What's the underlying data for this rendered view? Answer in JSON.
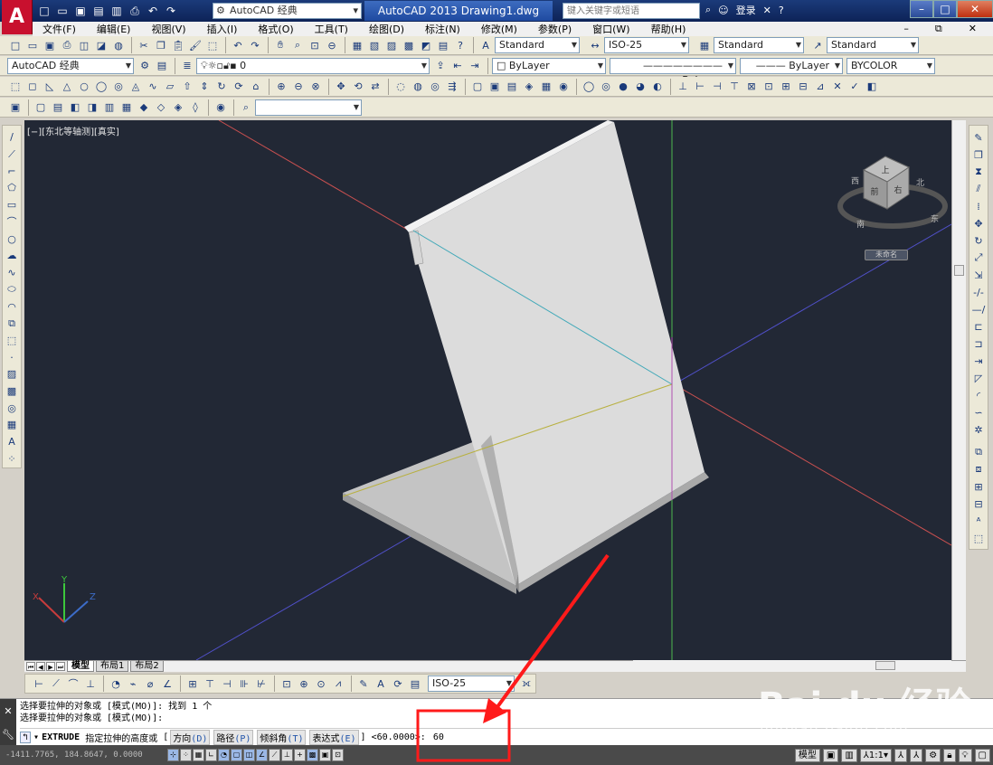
{
  "app": {
    "logo": "A",
    "workspace": "AutoCAD 经典",
    "title": "AutoCAD 2013    Drawing1.dwg",
    "search_placeholder": "键入关键字或短语",
    "login": "登录",
    "help": "?"
  },
  "menu": [
    "文件(F)",
    "编辑(E)",
    "视图(V)",
    "插入(I)",
    "格式(O)",
    "工具(T)",
    "绘图(D)",
    "标注(N)",
    "修改(M)",
    "参数(P)",
    "窗口(W)",
    "帮助(H)"
  ],
  "styles": {
    "text_style": "Standard",
    "dim_style": "ISO-25",
    "table_style": "Standard",
    "multileader_style": "Standard"
  },
  "layers": {
    "workspace_combo": "AutoCAD 经典",
    "layer_name": "0",
    "color": "ByLayer",
    "linetype": "ByLayer",
    "lineweight": "ByLayer",
    "plot_style": "BYCOLOR"
  },
  "viewport": {
    "label": "[−][东北等轴测][真实]",
    "viewcube_top": "上",
    "viewcube_front": "前",
    "viewcube_right": "右",
    "compass_n": "北",
    "compass_e": "东",
    "compass_s": "南",
    "compass_w": "西",
    "ucs_label": "未命名",
    "ucs_axes": {
      "x": "X",
      "y": "Y",
      "z": "Z"
    }
  },
  "layout_tabs": [
    "模型",
    "布局1",
    "布局2"
  ],
  "dim_toolbar": {
    "dim_style": "ISO-25"
  },
  "command": {
    "history": [
      "选择要拉伸的对象或 [模式(MO)]: 找到 1 个",
      "选择要拉伸的对象或 [模式(MO)]:"
    ],
    "prompt_cmd": "EXTRUDE",
    "prompt_text": "指定拉伸的高度或",
    "options": [
      {
        "label": "方向",
        "key": "(D)"
      },
      {
        "label": "路径",
        "key": "(P)"
      },
      {
        "label": "倾斜角",
        "key": "(T)"
      },
      {
        "label": "表达式",
        "key": "(E)"
      }
    ],
    "default": "<60.0000>:",
    "input_value": "60"
  },
  "status": {
    "coords": "-1411.7765, 184.8647, 0.0000",
    "model": "模型",
    "scale": "1:1"
  },
  "watermark": {
    "brand": "Bai du 经验",
    "url": "jingyan.baidu.com"
  },
  "colors": {
    "canvas_bg": "#222835",
    "highlight_box": "#ff0000",
    "axis_x": "#c85050",
    "axis_y": "#50c050",
    "axis_z": "#5050c8"
  }
}
